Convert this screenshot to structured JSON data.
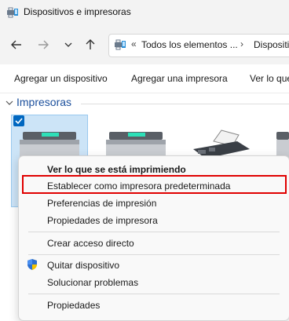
{
  "window": {
    "title": "Dispositivos e impresoras"
  },
  "nav": {
    "back_icon": "arrow-left-icon",
    "forward_icon": "arrow-right-icon",
    "recent_icon": "chevron-down-icon",
    "up_icon": "arrow-up-icon"
  },
  "address": {
    "separator": "«",
    "segment1": "Todos los elementos ...",
    "chevron": "›",
    "segment2": "Dispositiv"
  },
  "commands": {
    "add_device": "Agregar un dispositivo",
    "add_printer": "Agregar una impresora",
    "see_queue": "Ver lo que"
  },
  "group": {
    "title": "Impresoras"
  },
  "context_menu": {
    "items": [
      "Ver lo que se está imprimiendo",
      "Establecer como impresora predeterminada",
      "Preferencias de impresión",
      "Propiedades de impresora",
      "Crear acceso directo",
      "Quitar dispositivo",
      "Solucionar problemas",
      "Propiedades"
    ]
  },
  "colors": {
    "accent": "#0067c0",
    "group_title": "#1b4f9c",
    "highlight_border": "#e00000",
    "selection": "#cce4f7"
  }
}
